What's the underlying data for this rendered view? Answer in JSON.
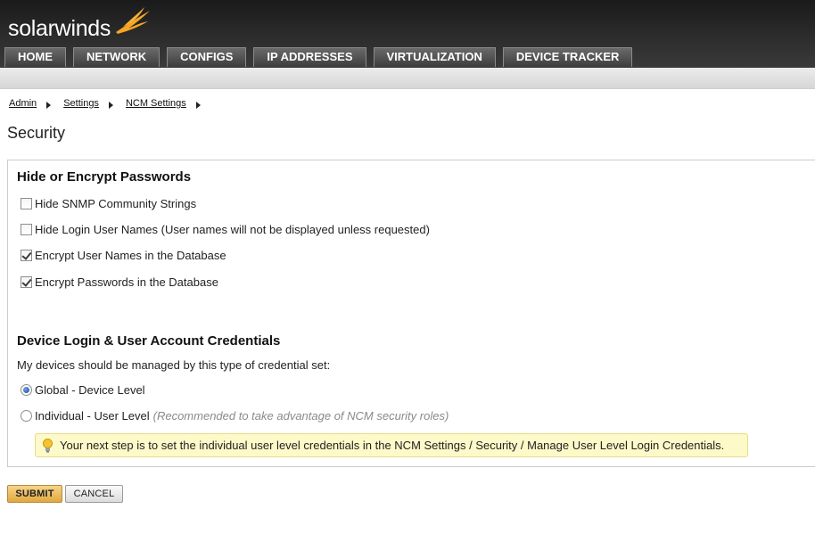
{
  "header": {
    "logo_text": "solarwinds",
    "brand_color": "#f5a623",
    "nav_tabs": [
      "HOME",
      "NETWORK",
      "CONFIGS",
      "IP ADDRESSES",
      "VIRTUALIZATION",
      "DEVICE TRACKER"
    ]
  },
  "breadcrumb": [
    "Admin",
    "Settings",
    "NCM Settings"
  ],
  "page_title": "Security",
  "passwords_section": {
    "heading": "Hide or Encrypt Passwords",
    "options": [
      {
        "label": "Hide SNMP Community Strings",
        "checked": false
      },
      {
        "label": "Hide Login User Names (User names will not be displayed unless requested)",
        "checked": false
      },
      {
        "label": "Encrypt User Names in the Database",
        "checked": true
      },
      {
        "label": "Encrypt Passwords in the Database",
        "checked": true
      }
    ]
  },
  "credentials_section": {
    "heading": "Device Login & User Account Credentials",
    "description": "My devices should be managed by this type of credential set:",
    "global_label": "Global - Device Level",
    "individual_label": "Individual - User Level",
    "individual_note": "(Recommended to take advantage of NCM security roles)",
    "selected": "global",
    "hint_icon": "lightbulb-icon",
    "hint": "Your next step is to set the individual user level credentials in the NCM Settings / Security / Manage User Level Login Credentials."
  },
  "buttons": {
    "submit": "SUBMIT",
    "cancel": "CANCEL"
  }
}
